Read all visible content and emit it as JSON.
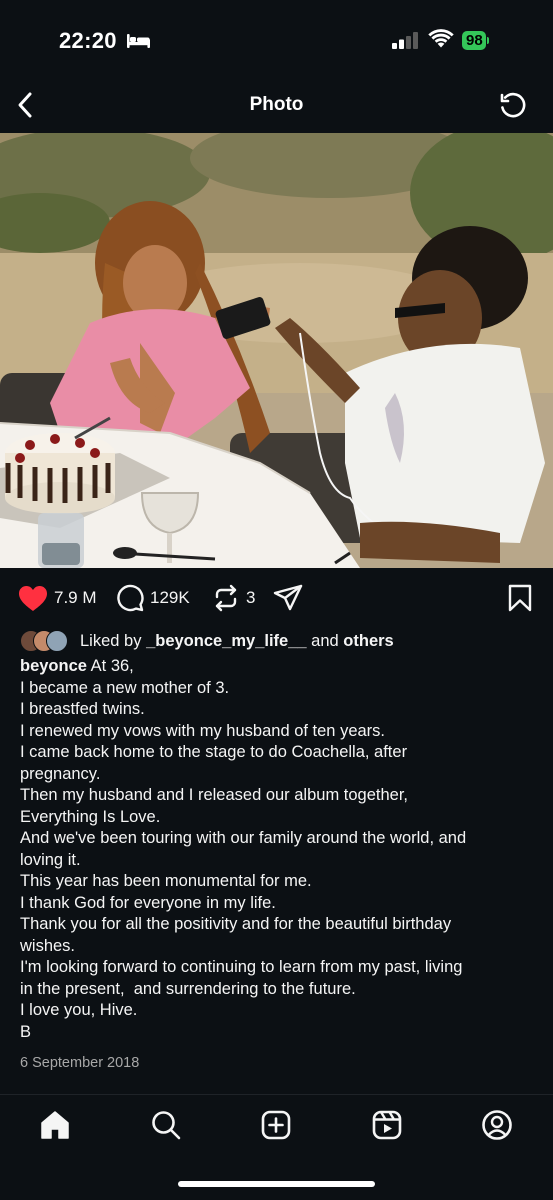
{
  "status_bar": {
    "time": "22:20",
    "battery": "98"
  },
  "header": {
    "title": "Photo"
  },
  "photo": {
    "sky_color": "#c9b89a",
    "table_color": "#f4f1ec"
  },
  "actions": {
    "likes": "7.9 M",
    "comments": "129K",
    "reposts": "3",
    "like_color": "#ff3040"
  },
  "liked_by": {
    "prefix": "Liked by",
    "user": "_beyonce_my_life__",
    "middle": "and",
    "others": "others"
  },
  "caption": {
    "username": "beyonce",
    "first_line": "At 36,",
    "lines": [
      "I became a new mother of 3.",
      "I breastfed twins.",
      "I renewed my vows with my husband of ten years.",
      "I came back home to the stage to do Coachella, after",
      "pregnancy.",
      "Then my husband and I released our album together,",
      "Everything Is Love.",
      "And we've been touring with our family around the world, and",
      "loving it.",
      "This year has been monumental for me.",
      "I thank God for everyone in my life.",
      "Thank you for all the positivity and for the beautiful birthday",
      "wishes.",
      "I'm looking forward to continuing to learn from my past, living",
      "in the present,  and surrendering to the future.",
      "I love you, Hive.",
      "B"
    ]
  },
  "date": "6 September 2018",
  "bottom_nav": {
    "items": [
      "home",
      "search",
      "create",
      "reels",
      "profile"
    ]
  }
}
